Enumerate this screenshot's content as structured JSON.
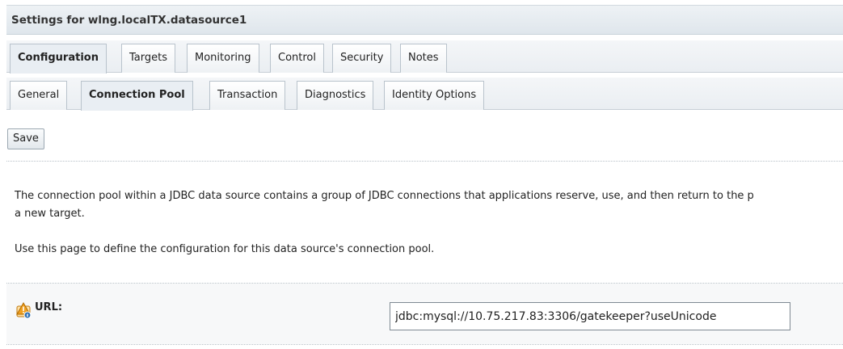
{
  "header": {
    "title": "Settings for wlng.localTX.datasource1"
  },
  "primary_tabs": [
    {
      "label": "Configuration",
      "active": true
    },
    {
      "label": "Targets",
      "active": false
    },
    {
      "label": "Monitoring",
      "active": false
    },
    {
      "label": "Control",
      "active": false
    },
    {
      "label": "Security",
      "active": false
    },
    {
      "label": "Notes",
      "active": false
    }
  ],
  "secondary_tabs": [
    {
      "label": "General",
      "active": false
    },
    {
      "label": "Connection Pool",
      "active": true
    },
    {
      "label": "Transaction",
      "active": false
    },
    {
      "label": "Diagnostics",
      "active": false
    },
    {
      "label": "Identity Options",
      "active": false
    }
  ],
  "toolbar": {
    "save_label": "Save"
  },
  "description": {
    "line1": "The connection pool within a JDBC data source contains a group of JDBC connections that applications reserve, use, and then return to the p",
    "line2": "a new target.",
    "line3": "Use this page to define the configuration for this data source's connection pool."
  },
  "url_field": {
    "label": "URL:",
    "value": "jdbc:mysql://10.75.217.83:3306/gatekeeper?useUnicode",
    "icon": "info-warning-icon"
  },
  "colors": {
    "accent": "#e9eef3",
    "header_bg": "#dfe6ec",
    "icon_orange": "#f0a020"
  }
}
